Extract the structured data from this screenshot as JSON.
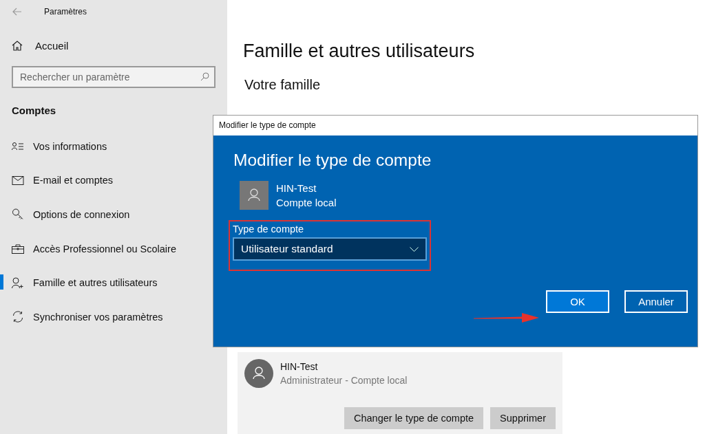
{
  "window": {
    "title": "Paramètres"
  },
  "sidebar": {
    "home": "Accueil",
    "search": {
      "placeholder": "Rechercher un paramètre"
    },
    "section": "Comptes",
    "items": [
      {
        "label": "Vos informations",
        "kind": "person-list",
        "selected": false
      },
      {
        "label": "E-mail et comptes",
        "kind": "mail",
        "selected": false
      },
      {
        "label": "Options de connexion",
        "kind": "key",
        "selected": false
      },
      {
        "label": "Accès Professionnel ou Scolaire",
        "kind": "briefcase",
        "selected": false
      },
      {
        "label": "Famille et autres utilisateurs",
        "kind": "person-add",
        "selected": true
      },
      {
        "label": "Synchroniser vos paramètres",
        "kind": "sync",
        "selected": false
      }
    ]
  },
  "page": {
    "title": "Famille et autres utilisateurs",
    "section": "Votre famille",
    "user_card": {
      "name": "HIN-Test",
      "subtitle": "Administrateur - Compte local",
      "buttons": [
        "Changer le type de compte",
        "Supprimer"
      ]
    }
  },
  "dialog": {
    "window_title": "Modifier le type de compte",
    "heading": "Modifier le type de compte",
    "user": {
      "name": "HIN-Test",
      "subtitle": "Compte local"
    },
    "field_label": "Type de compte",
    "value": "Utilisateur standard",
    "buttons": [
      {
        "label": "OK",
        "kind": "primary"
      },
      {
        "label": "Annuler",
        "kind": "secondary"
      }
    ]
  }
}
